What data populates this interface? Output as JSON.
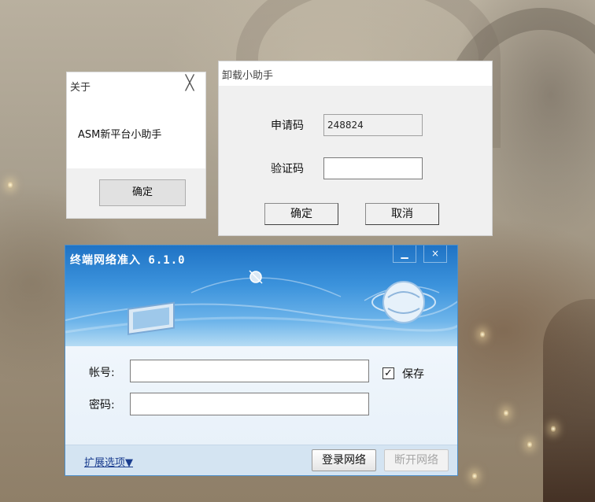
{
  "about_dialog": {
    "title": "关于",
    "close_glyph": "╳",
    "message": "ASM新平台小助手",
    "ok_label": "确定"
  },
  "uninstall_dialog": {
    "title": "卸载小助手",
    "code_label": "申请码",
    "code_value": "248824",
    "verify_label": "验证码",
    "verify_value": "",
    "ok_label": "确定",
    "cancel_label": "取消"
  },
  "login_window": {
    "title": "终端网络准入 6.1.0",
    "minimize_glyph": "▁",
    "close_glyph": "×",
    "account_label": "帐号:",
    "account_value": "",
    "password_label": "密码:",
    "password_value": "",
    "save_checked": true,
    "save_check_glyph": "✓",
    "save_label": "保存",
    "expand_label": "扩展选项▼",
    "login_label": "登录网络",
    "disconnect_label": "断开网络",
    "banner_colors": {
      "top": "#1f73c5",
      "bottom": "#b6dcf4"
    }
  }
}
